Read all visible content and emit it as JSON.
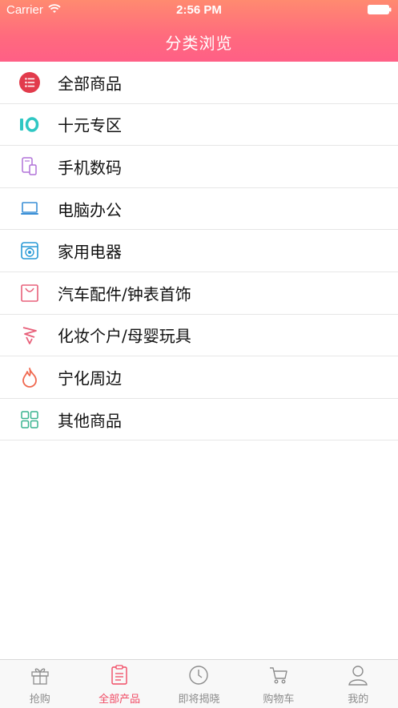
{
  "status_bar": {
    "carrier": "Carrier",
    "time": "2:56 PM"
  },
  "header": {
    "title": "分类浏览"
  },
  "categories": [
    {
      "label": "全部商品",
      "icon": "list-circle-icon"
    },
    {
      "label": "十元专区",
      "icon": "ten-icon"
    },
    {
      "label": "手机数码",
      "icon": "phone-icon"
    },
    {
      "label": "电脑办公",
      "icon": "laptop-icon"
    },
    {
      "label": "家用电器",
      "icon": "appliance-icon"
    },
    {
      "label": "汽车配件/钟表首饰",
      "icon": "bag-icon"
    },
    {
      "label": "化妆个户/母婴玩具",
      "icon": "ribbon-icon"
    },
    {
      "label": "宁化周边",
      "icon": "flame-icon"
    },
    {
      "label": "其他商品",
      "icon": "grid-icon"
    }
  ],
  "tabs": [
    {
      "label": "抢购",
      "icon": "gift-icon",
      "active": false
    },
    {
      "label": "全部产品",
      "icon": "clipboard-icon",
      "active": true
    },
    {
      "label": "即将揭晓",
      "icon": "clock-icon",
      "active": false
    },
    {
      "label": "购物车",
      "icon": "cart-icon",
      "active": false
    },
    {
      "label": "我的",
      "icon": "user-icon",
      "active": false
    }
  ],
  "colors": {
    "header_top": "#ff8a70",
    "header_bottom": "#ff5f86",
    "accent": "#f04a63",
    "tab_inactive": "#8c8c8c"
  }
}
